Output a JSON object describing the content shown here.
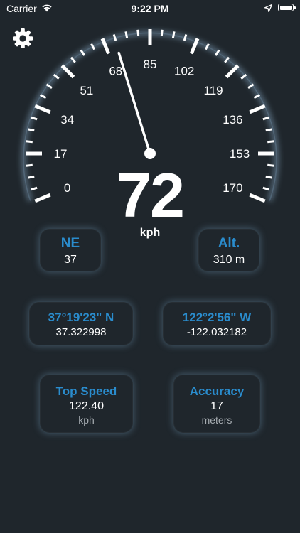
{
  "status_bar": {
    "carrier": "Carrier",
    "time": "9:22 PM"
  },
  "settings": {
    "icon": "gear-icon"
  },
  "gauge": {
    "min": 0,
    "max": 170,
    "labels": [
      "0",
      "17",
      "34",
      "51",
      "68",
      "85",
      "102",
      "119",
      "136",
      "153",
      "170"
    ],
    "needle_value": 72
  },
  "speed": {
    "value": "72",
    "unit": "kph"
  },
  "heading": {
    "title": "NE",
    "value": "37"
  },
  "altitude": {
    "title": "Alt.",
    "value": "310 m"
  },
  "latitude": {
    "dms": "37°19'23\" N",
    "decimal": "37.322998"
  },
  "longitude": {
    "dms": "122°2'56\" W",
    "decimal": "-122.032182"
  },
  "top_speed": {
    "title": "Top Speed",
    "value": "122.40",
    "unit": "kph"
  },
  "accuracy": {
    "title": "Accuracy",
    "value": "17",
    "unit": "meters"
  },
  "colors": {
    "background": "#1f262c",
    "accent": "#2a8ccd",
    "text": "#ffffff",
    "subtext": "#a7adb2"
  }
}
